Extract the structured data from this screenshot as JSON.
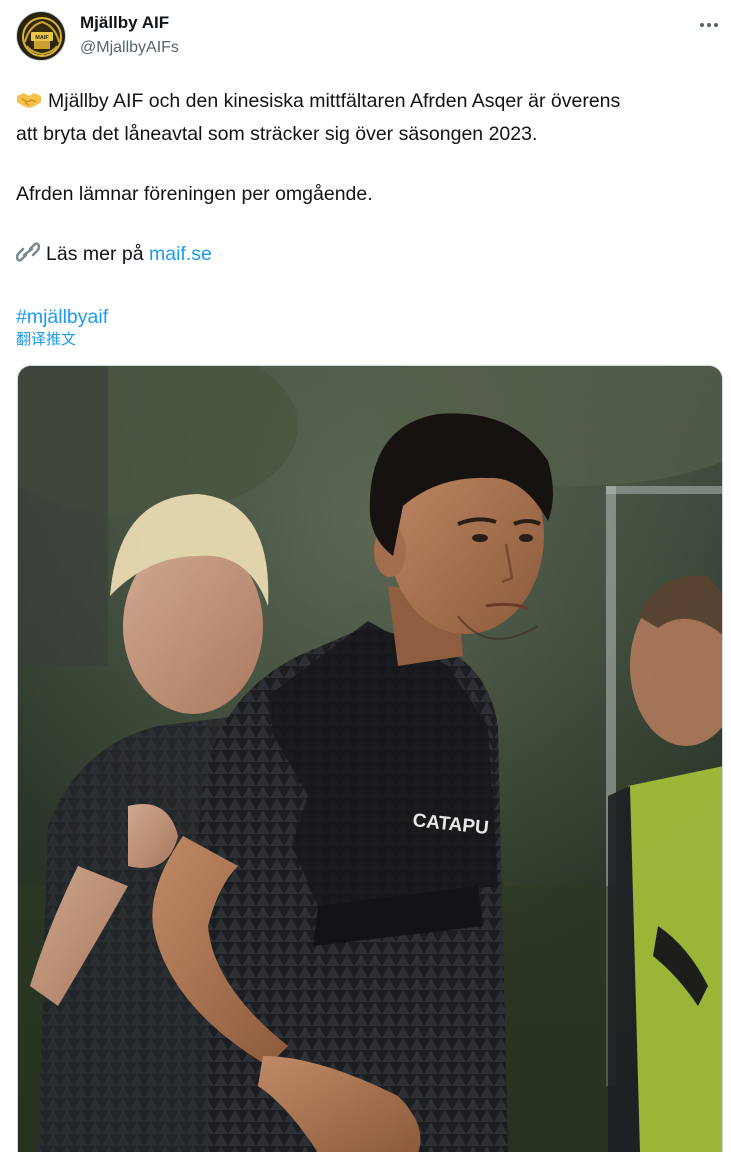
{
  "tweet": {
    "author": {
      "name": "Mjällby AIF",
      "handle": "@MjallbyAIFs",
      "avatar_icon": "club-crest-icon"
    },
    "more_icon": "more-options-icon",
    "text": {
      "line1": "Mjällby AIF och den kinesiska mittfältaren Afrden Asqer är överens",
      "line2": "att bryta det låneavtal som sträcker sig över säsongen 2023.",
      "line3": "Afrden lämnar föreningen per omgående.",
      "link_prefix": "Läs mer på",
      "link_text": "maif.se",
      "hashtag": "#mjällbyaif"
    },
    "translate_label": "翻译推文",
    "media": {
      "alt_icon": "photo",
      "shirt_text": "CATAPU"
    }
  },
  "colors": {
    "link": "#1d9bf0",
    "text": "#0f1419",
    "secondary": "#536471"
  }
}
